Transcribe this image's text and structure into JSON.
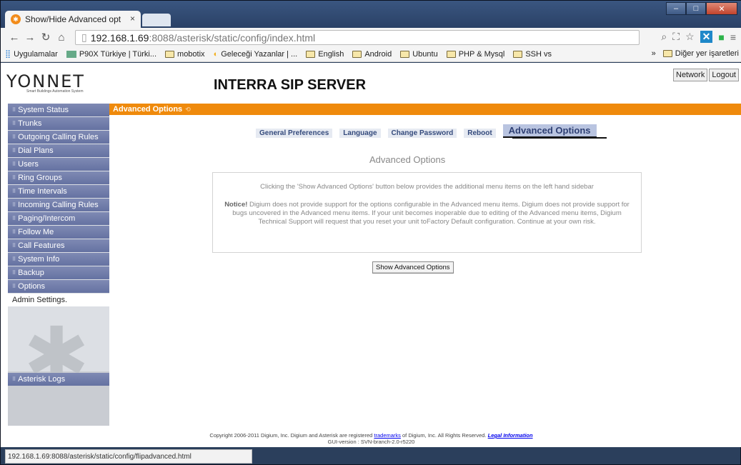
{
  "browser": {
    "tab_title": "Show/Hide Advanced opt",
    "tab_close": "×",
    "url_host": "192.168.1.69",
    "url_path": ":8088/asterisk/static/config/index.html",
    "bookmarks": [
      "Uygulamalar",
      "P90X Türkiye | Türki...",
      "mobotix",
      "Geleceği Yazanlar | ...",
      "English",
      "Android",
      "Ubuntu",
      "PHP & Mysql",
      "SSH vs"
    ],
    "bookmarks_more": "»",
    "other_bookmarks": "Diğer yer işaretleri",
    "status_url": "192.168.1.69:8088/asterisk/static/config/flipadvanced.html"
  },
  "header": {
    "logo": "YONNET",
    "logo_sub": "Smart Buildings Automation System",
    "title": "INTERRA SIP SERVER",
    "network_btn": "Network",
    "logout_btn": "Logout"
  },
  "sidebar": {
    "items": [
      "System Status",
      "Trunks",
      "Outgoing Calling Rules",
      "Dial Plans",
      "Users",
      "Ring Groups",
      "Time Intervals",
      "Incoming Calling Rules",
      "Paging/Intercom",
      "Follow Me",
      "Call Features",
      "System Info",
      "Backup",
      "Options"
    ],
    "admin": "Admin Settings.",
    "logs": "Asterisk Logs"
  },
  "main": {
    "bar_title": "Advanced Options",
    "tabs": [
      "General Preferences",
      "Language",
      "Change Password",
      "Reboot"
    ],
    "active_tab": "Advanced Options",
    "section_title": "Advanced Options",
    "info_text": "Clicking the 'Show Advanced Options' button below provides the additional menu items on the left hand sidebar",
    "notice_label": "Notice!",
    "notice_text": " Digium does not provide support for the options configurable in the Advanced menu items. Digium does not provide support for bugs uncovered in the Advanced menu items. If your unit becomes inoperable due to editing of the Advanced menu items, Digium Technical Support will request that you reset your unit toFactory Default configuration. Continue at your own risk.",
    "show_button": "Show Advanced Options"
  },
  "footer": {
    "copyright_pre": "Copyright 2006-2011 Digium, Inc. Digium and Asterisk are registered ",
    "trademarks": "trademarks",
    "copyright_post": " of Digium, Inc. All Rights Reserved. ",
    "legal": "Legal Information",
    "gui_version": "GUI-version : SVN-branch-2.0-r5220"
  }
}
